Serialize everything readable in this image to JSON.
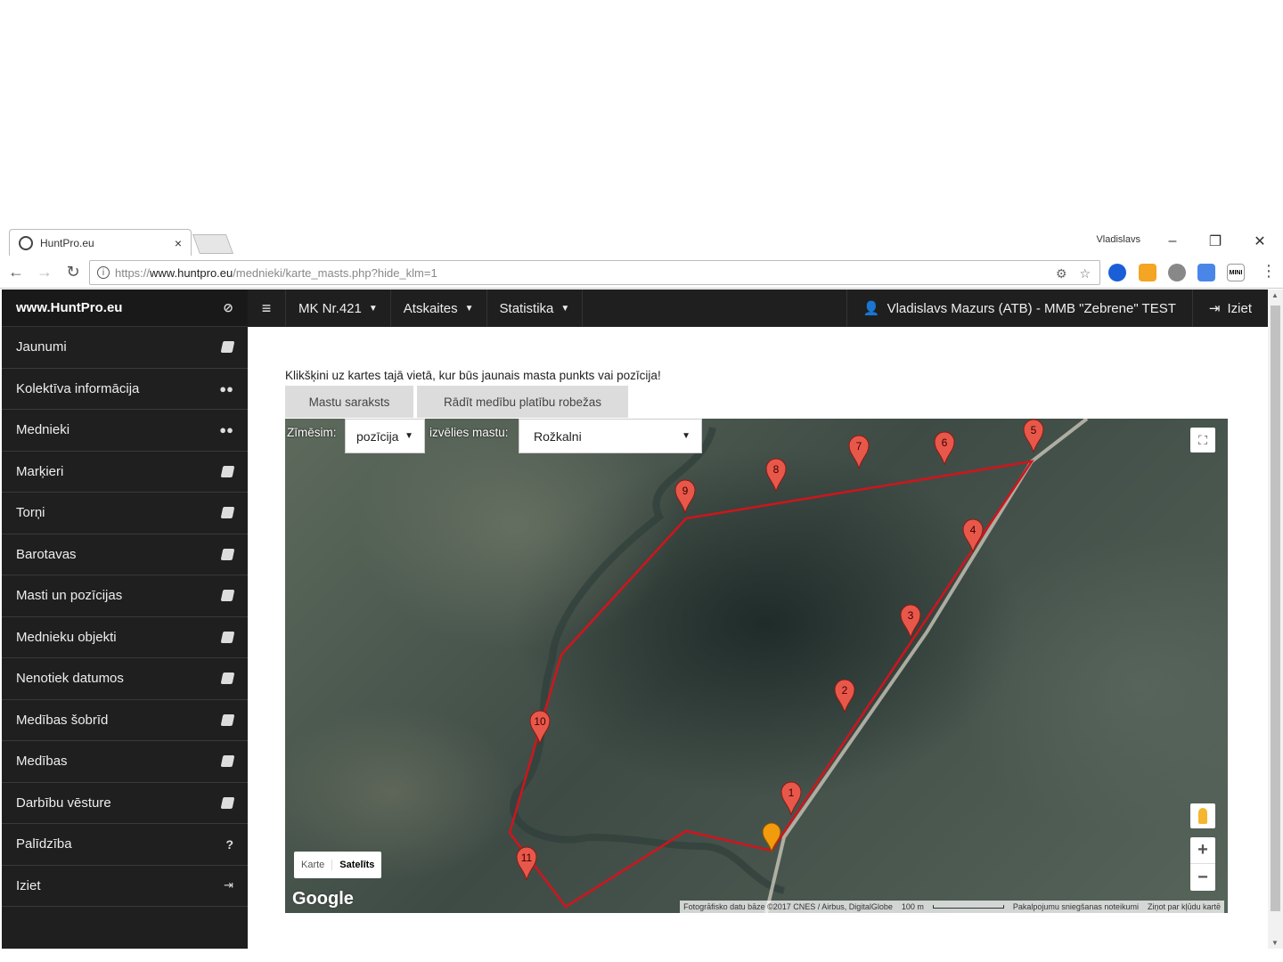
{
  "browser": {
    "tab_title": "HuntPro.eu",
    "tab_close": "×",
    "window_user": "Vladislavs",
    "url_scheme": "https://",
    "url_host": "www.huntpro.eu",
    "url_path": "/mednieki/karte_masts.php?hide_klm=1"
  },
  "sidebar": {
    "brand": "www.HuntPro.eu",
    "items": [
      {
        "label": "Jaunumi",
        "icon": "book-icon"
      },
      {
        "label": "Kolektīva informācija",
        "icon": "users-icon"
      },
      {
        "label": "Mednieki",
        "icon": "users-icon"
      },
      {
        "label": "Marķieri",
        "icon": "book-icon"
      },
      {
        "label": "Torņi",
        "icon": "book-icon"
      },
      {
        "label": "Barotavas",
        "icon": "book-icon"
      },
      {
        "label": "Masti un pozīcijas",
        "icon": "book-icon"
      },
      {
        "label": "Mednieku objekti",
        "icon": "book-icon"
      },
      {
        "label": "Nenotiek datumos",
        "icon": "book-icon"
      },
      {
        "label": "Medības šobrīd",
        "icon": "book-icon"
      },
      {
        "label": "Medības",
        "icon": "book-icon"
      },
      {
        "label": "Darbību vēsture",
        "icon": "book-icon"
      },
      {
        "label": "Palīdzība",
        "icon": "question-icon"
      },
      {
        "label": "Iziet",
        "icon": "sign-out-icon"
      }
    ]
  },
  "topnav": {
    "menus": [
      "MK Nr.421",
      "Atskaites",
      "Statistika"
    ],
    "user": "Vladislavs Mazurs (ATB) - MMB \"Zebrene\" TEST",
    "exit": "Iziet"
  },
  "main": {
    "instruction": "Klikšķini uz kartes tajā vietā, kur būs jaunais masta punkts vai pozīcija!",
    "tab_list": "Mastu saraksts",
    "tab_bounds": "Rādīt medību platību robežas"
  },
  "map": {
    "draw_label": "Zīmēsim:",
    "draw_value": "pozīcija",
    "mast_label": "izvēlies mastu:",
    "mast_value": "Rožkalni",
    "maptype_map": "Karte",
    "maptype_sat": "Satelīts",
    "google": "Google",
    "attribution_imagery": "Fotogrāfisko datu bāze ©2017 CNES / Airbus, DigitalGlobe",
    "attribution_scale": "100 m",
    "attribution_terms": "Pakalpojumu sniegšanas noteikumi",
    "attribution_report": "Ziņot par kļūdu kartē",
    "zoom_in": "+",
    "zoom_out": "−",
    "marker_labels": [
      "1",
      "2",
      "3",
      "4",
      "5",
      "6",
      "7",
      "8",
      "9",
      "10",
      "11"
    ],
    "colors": {
      "boundary": "#d1141c",
      "marker": "#e8584a",
      "position_marker": "#f29b0c"
    }
  }
}
